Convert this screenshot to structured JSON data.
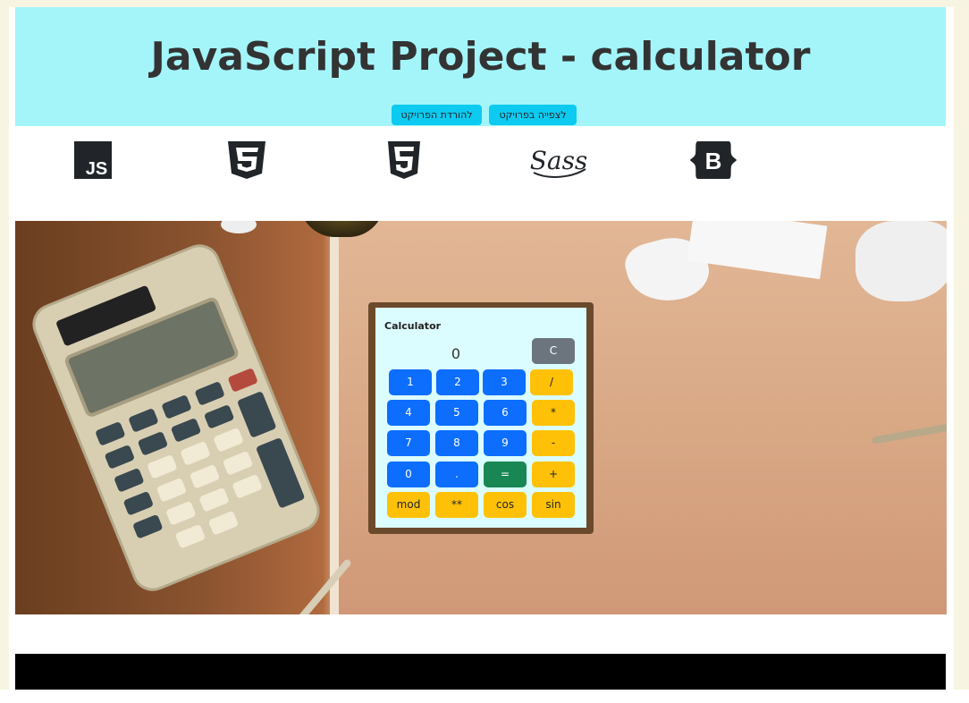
{
  "header": {
    "title": "JavaScript Project - calculator",
    "view_project_label": "לצפייה בפרויקט <<",
    "download_project_label": "להורדת הפרויקט <<"
  },
  "tech_icons": [
    {
      "name": "javascript-icon",
      "text": "JS"
    },
    {
      "name": "css3-icon"
    },
    {
      "name": "html5-icon"
    },
    {
      "name": "sass-icon",
      "text": "Sass"
    },
    {
      "name": "bootstrap-icon",
      "text": "B"
    }
  ],
  "calculator": {
    "title": "Calculator",
    "display": "0",
    "clear_label": "C",
    "rows": [
      [
        "1",
        "2",
        "3",
        "/"
      ],
      [
        "4",
        "5",
        "6",
        "*"
      ],
      [
        "7",
        "8",
        "9",
        "-"
      ],
      [
        "0",
        ".",
        "=",
        "+"
      ],
      [
        "mod",
        "**",
        "cos",
        "sin"
      ]
    ]
  },
  "colors": {
    "header_bg": "#a3f5f9",
    "button_info": "#0dcaf0",
    "number_button": "#0d6efd",
    "operator_button": "#ffc107",
    "equals_button": "#198754",
    "clear_button": "#6c757d",
    "calc_bg": "#dcfdff",
    "footer": "#000000"
  }
}
